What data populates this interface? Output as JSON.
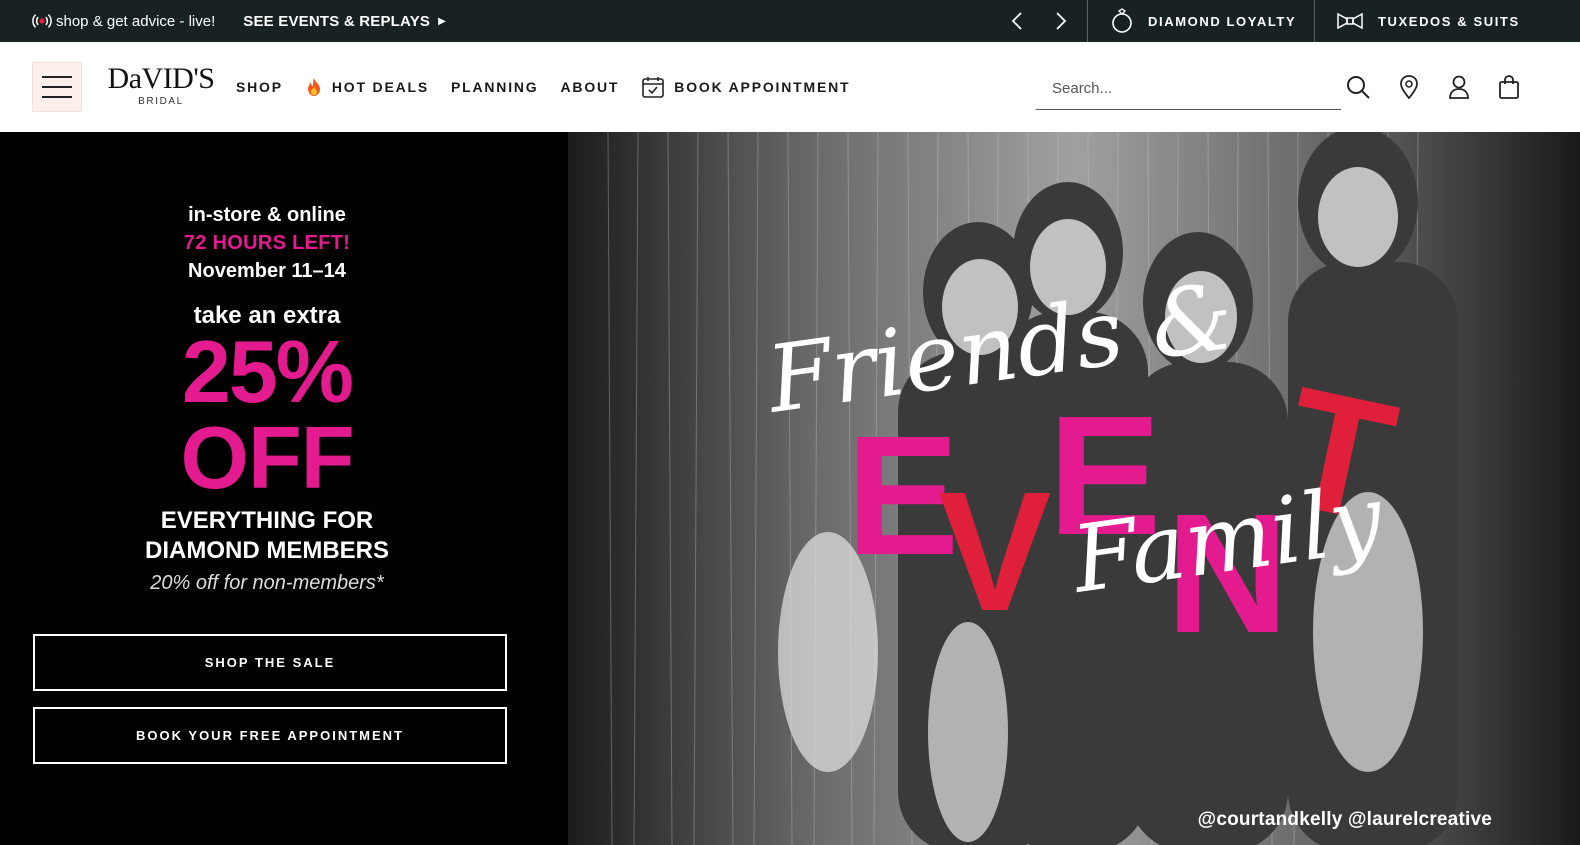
{
  "topbar": {
    "live_text": "shop & get advice - live!",
    "events_label": "SEE EVENTS & REPLAYS",
    "diamond_label": "DIAMOND LOYALTY",
    "tuxedo_label": "TUXEDOS & SUITS",
    "icons": [
      "live-broadcast-icon",
      "caret-right-icon",
      "chevron-left-icon",
      "chevron-right-icon",
      "diamond-ring-icon",
      "bow-tie-icon"
    ]
  },
  "header": {
    "logo_main": "DaVID'S",
    "logo_sub": "BRIDAL",
    "nav": {
      "shop": "SHOP",
      "hot_deals": "HOT DEALS",
      "planning": "PLANNING",
      "about": "ABOUT",
      "book_appointment": "BOOK APPOINTMENT"
    },
    "search_placeholder": "Search...",
    "icons": [
      "menu-icon",
      "flame-icon",
      "calendar-icon",
      "search-icon",
      "location-pin-icon",
      "user-icon",
      "shopping-bag-icon"
    ]
  },
  "hero": {
    "line1": "in-store & online",
    "line2": "72 HOURS LEFT!",
    "line3": "November 11–14",
    "take_extra": "take an extra",
    "percent": "25%",
    "off": "OFF",
    "everything_1": "EVERYTHING FOR",
    "everything_2": "DIAMOND MEMBERS",
    "non_members": "20% off for non-members*",
    "shop_button": "SHOP THE SALE",
    "book_button": "BOOK YOUR FREE APPOINTMENT",
    "photo_script_1": "Friends &",
    "photo_script_2": "Family",
    "photo_big": "EVENT",
    "credit": "@courtandkelly @laurelcreative"
  },
  "colors": {
    "topbar_bg": "#182224",
    "accent_pink": "#e41b8f",
    "accent_red": "#e0203a",
    "menu_bg": "#fbf0ec"
  }
}
